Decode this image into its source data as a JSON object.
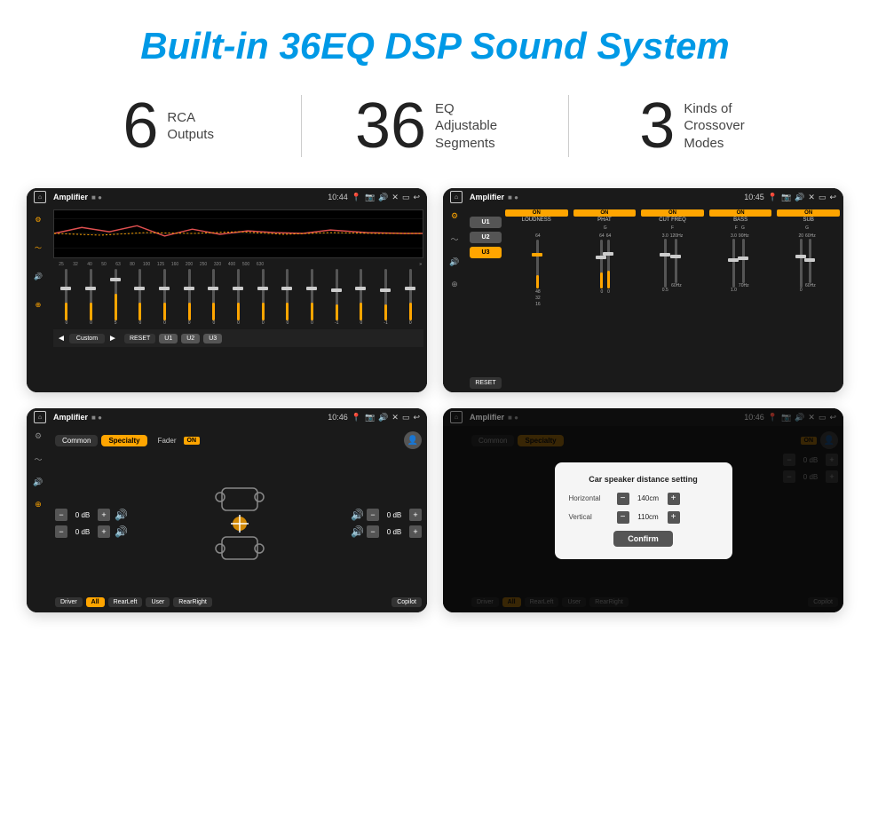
{
  "header": {
    "title": "Built-in 36EQ DSP Sound System"
  },
  "stats": [
    {
      "number": "6",
      "label": "RCA\nOutputs"
    },
    {
      "number": "36",
      "label": "EQ Adjustable\nSegments"
    },
    {
      "number": "3",
      "label": "Kinds of\nCrossover Modes"
    }
  ],
  "screens": {
    "eq": {
      "app_name": "Amplifier",
      "time": "10:44",
      "freq_labels": [
        "25",
        "32",
        "40",
        "50",
        "63",
        "80",
        "100",
        "125",
        "160",
        "200",
        "250",
        "320",
        "400",
        "500",
        "630"
      ],
      "values": [
        "0",
        "0",
        "5",
        "0",
        "0",
        "0",
        "0",
        "0",
        "0",
        "0",
        "0",
        "-1",
        "0",
        "-1"
      ],
      "bottom_btns": [
        "Custom",
        "RESET",
        "U1",
        "U2",
        "U3"
      ]
    },
    "channel": {
      "app_name": "Amplifier",
      "time": "10:45",
      "presets": [
        "U1",
        "U2",
        "U3"
      ],
      "channels": [
        "LOUDNESS",
        "PHAT",
        "CUT FREQ",
        "BASS",
        "SUB"
      ],
      "channel_labels": [
        "G",
        "F",
        "F",
        "G",
        "G"
      ]
    },
    "fader": {
      "app_name": "Amplifier",
      "time": "10:46",
      "tabs": [
        "Common",
        "Specialty"
      ],
      "fader_label": "Fader",
      "on_badge": "ON",
      "db_values": [
        "0 dB",
        "0 dB",
        "0 dB",
        "0 dB"
      ],
      "bottom_btns": [
        "Driver",
        "All",
        "RearLeft",
        "User",
        "RearRight",
        "Copilot"
      ]
    },
    "distance": {
      "app_name": "Amplifier",
      "time": "10:46",
      "tabs": [
        "Common",
        "Specialty"
      ],
      "on_badge": "ON",
      "dialog": {
        "title": "Car speaker distance setting",
        "horizontal_label": "Horizontal",
        "horizontal_value": "140cm",
        "vertical_label": "Vertical",
        "vertical_value": "110cm",
        "confirm_btn": "Confirm"
      },
      "db_values": [
        "0 dB",
        "0 dB"
      ],
      "bottom_btns": [
        "Driver",
        "All",
        "RearLeft",
        "User",
        "RearRight",
        "Copilot"
      ]
    }
  },
  "colors": {
    "accent": "#ffa500",
    "blue_title": "#0099e6",
    "dark_bg": "#111111",
    "bar_bg": "#1a1a1a"
  }
}
